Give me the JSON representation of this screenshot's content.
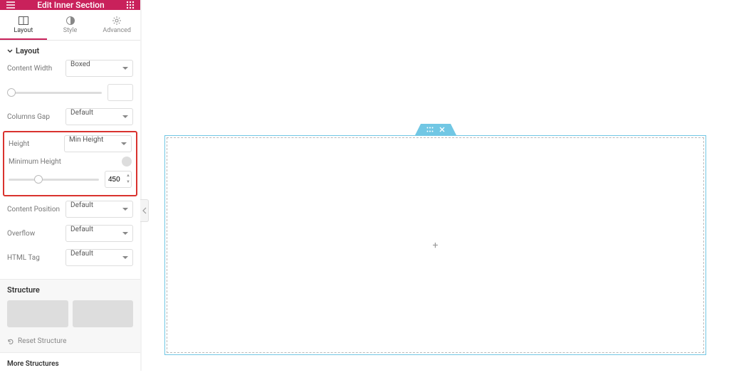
{
  "header": {
    "title": "Edit Inner Section"
  },
  "tabs": {
    "layout": "Layout",
    "style": "Style",
    "advanced": "Advanced",
    "active": "layout"
  },
  "layout": {
    "section_title": "Layout",
    "content_width": {
      "label": "Content Width",
      "value": "Boxed"
    },
    "width_input": "",
    "columns_gap": {
      "label": "Columns Gap",
      "value": "Default"
    },
    "height": {
      "label": "Height",
      "value": "Min Height"
    },
    "min_height": {
      "label": "Minimum Height",
      "value": "450"
    },
    "content_position": {
      "label": "Content Position",
      "value": "Default"
    },
    "overflow": {
      "label": "Overflow",
      "value": "Default"
    },
    "html_tag": {
      "label": "HTML Tag",
      "value": "Default"
    }
  },
  "structure": {
    "title": "Structure",
    "reset": "Reset Structure",
    "more": "More Structures"
  }
}
